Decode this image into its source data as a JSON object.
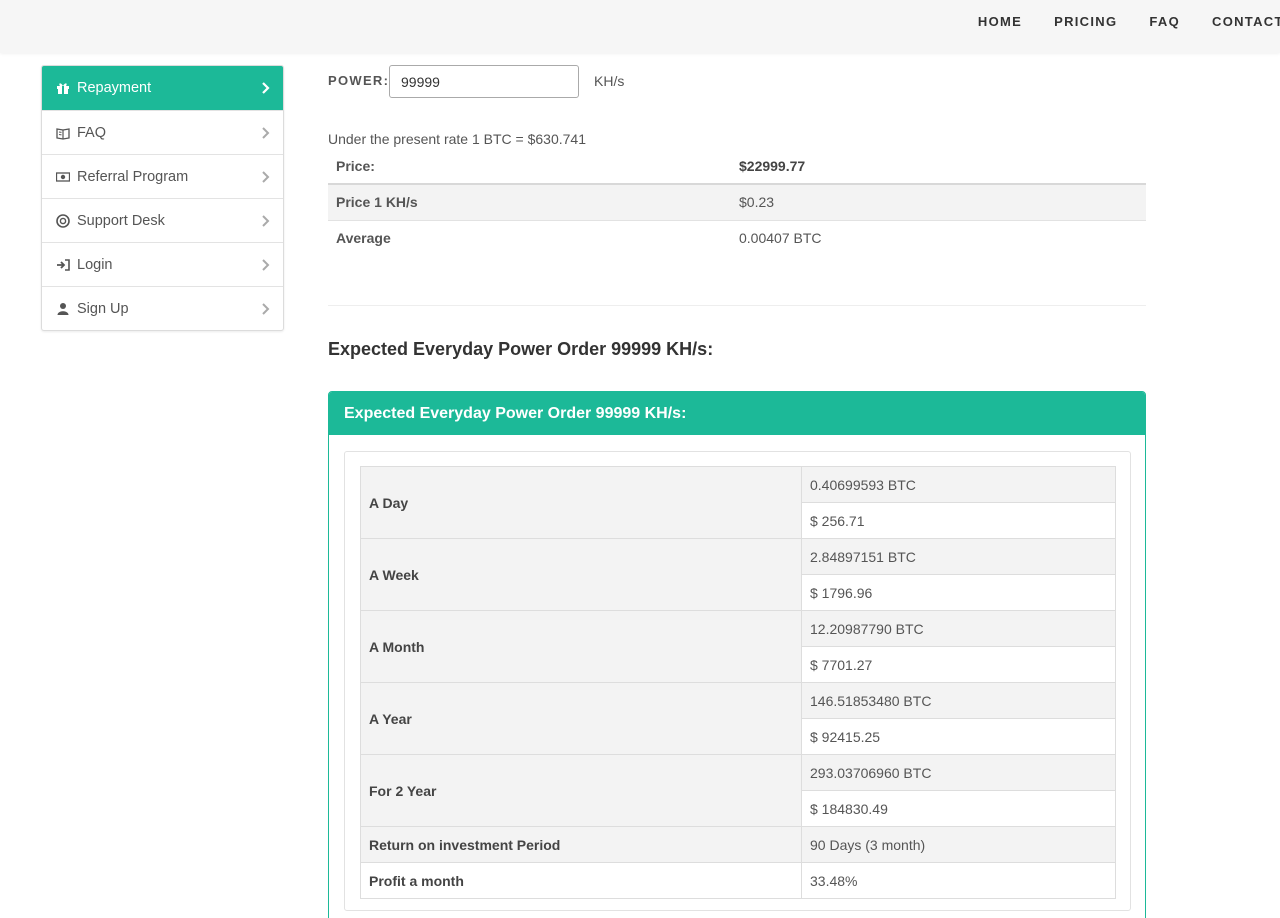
{
  "nav": {
    "items": [
      {
        "label": "HOME"
      },
      {
        "label": "PRICING"
      },
      {
        "label": "FAQ"
      },
      {
        "label": "CONTACT"
      }
    ]
  },
  "sidebar": {
    "items": [
      {
        "label": "Repayment",
        "icon": "gift-icon",
        "active": true
      },
      {
        "label": "FAQ",
        "icon": "book-icon",
        "active": false
      },
      {
        "label": "Referral Program",
        "icon": "money-icon",
        "active": false
      },
      {
        "label": "Support Desk",
        "icon": "lifebuoy-icon",
        "active": false
      },
      {
        "label": "Login",
        "icon": "sign-in-icon",
        "active": false
      },
      {
        "label": "Sign Up",
        "icon": "user-icon",
        "active": false
      }
    ]
  },
  "power": {
    "label": "POWER:",
    "value": "99999",
    "unit": "KH/s"
  },
  "rate_text": "Under the present rate 1 BTC = $630.741",
  "summary": {
    "rows": [
      {
        "label": "Price:",
        "value": "$22999.77"
      },
      {
        "label": "Price 1 KH/s",
        "value": "$0.23"
      },
      {
        "label": "Average",
        "value": "0.00407 BTC"
      }
    ]
  },
  "section_heading": "Expected Everyday Power Order 99999 KH/s:",
  "panel": {
    "title": "Expected Everyday Power Order 99999 KH/s:",
    "periods": [
      {
        "label": "A Day",
        "btc": "0.40699593 BTC",
        "usd": "$ 256.71"
      },
      {
        "label": "A Week",
        "btc": "2.84897151 BTC",
        "usd": "$ 1796.96"
      },
      {
        "label": "A Month",
        "btc": "12.20987790 BTC",
        "usd": "$ 7701.27"
      },
      {
        "label": "A Year",
        "btc": "146.51853480 BTC",
        "usd": "$ 92415.25"
      },
      {
        "label": "For 2 Year",
        "btc": "293.03706960 BTC",
        "usd": "$ 184830.49"
      }
    ],
    "roi": {
      "label": "Return on investment Period",
      "value": "90 Days (3 month)"
    },
    "profit": {
      "label": "Profit a month",
      "value": "33.48%"
    }
  },
  "colors": {
    "accent": "#1cb998",
    "row_alt": "#f3f3f3"
  }
}
